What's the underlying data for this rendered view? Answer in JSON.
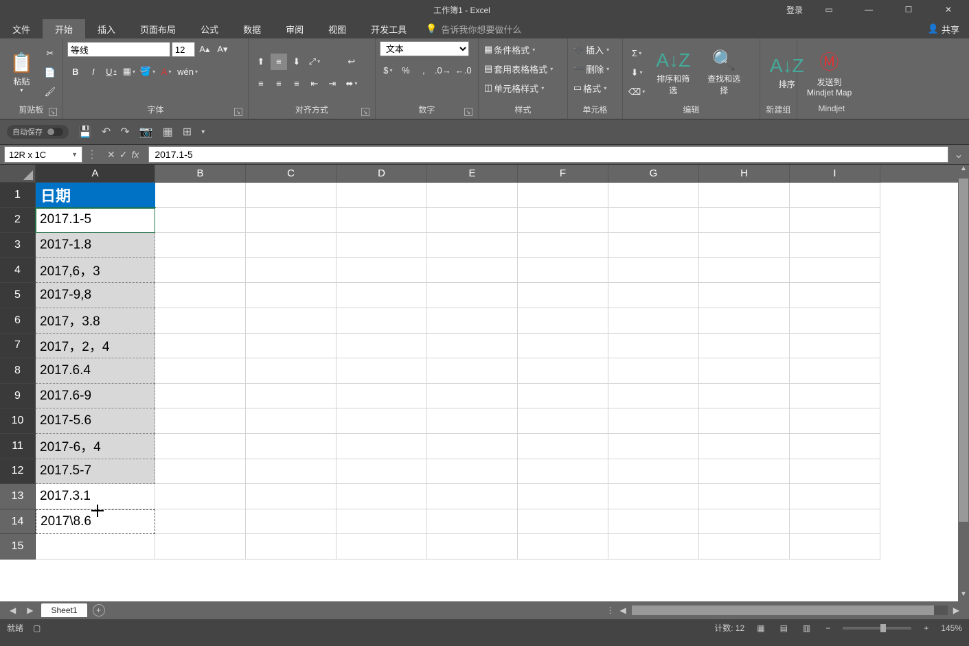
{
  "title": "工作簿1 - Excel",
  "login": "登录",
  "menuTabs": [
    "文件",
    "开始",
    "插入",
    "页面布局",
    "公式",
    "数据",
    "审阅",
    "视图",
    "开发工具"
  ],
  "activeTab": 1,
  "tellme": "告诉我你想要做什么",
  "share": "共享",
  "ribbon": {
    "clipboard": {
      "paste": "粘贴",
      "label": "剪贴板"
    },
    "font": {
      "name": "等线",
      "size": "12",
      "label": "字体",
      "bold": "B",
      "italic": "I",
      "underline": "U"
    },
    "align": {
      "label": "对齐方式"
    },
    "number": {
      "format": "文本",
      "label": "数字"
    },
    "styles": {
      "cond": "条件格式",
      "table": "套用表格格式",
      "cell": "单元格样式",
      "label": "样式"
    },
    "cells": {
      "insert": "插入",
      "delete": "删除",
      "format": "格式",
      "label": "单元格"
    },
    "editing": {
      "sort": "排序和筛选",
      "find": "查找和选择",
      "label": "编辑"
    },
    "newgroup": {
      "sortbtn": "排序",
      "label": "新建组"
    },
    "mindjet": {
      "send": "发送到",
      "map": "Mindjet Map",
      "label": "Mindjet"
    }
  },
  "qat": {
    "autosave": "自动保存"
  },
  "namebox": "12R x 1C",
  "formula": "2017.1-5",
  "columns": [
    "A",
    "B",
    "C",
    "D",
    "E",
    "F",
    "G",
    "H",
    "I"
  ],
  "rowHeaders": [
    "1",
    "2",
    "3",
    "4",
    "5",
    "6",
    "7",
    "8",
    "9",
    "10",
    "11",
    "12",
    "13",
    "14",
    "15"
  ],
  "cellsA": [
    "日期",
    "2017.1-5",
    "2017-1.8",
    "2017,6，3",
    "2017-9,8",
    "2017，3.8",
    "2017，2，4",
    "2017.6.4",
    "2017.6-9",
    "2017-5.6",
    "2017-6，4",
    "2017.5-7",
    "2017.3.1",
    "2017\\8.6",
    ""
  ],
  "sheet": {
    "name": "Sheet1"
  },
  "status": {
    "ready": "就绪",
    "count": "计数: 12",
    "zoom": "145%"
  },
  "chart_data": null
}
